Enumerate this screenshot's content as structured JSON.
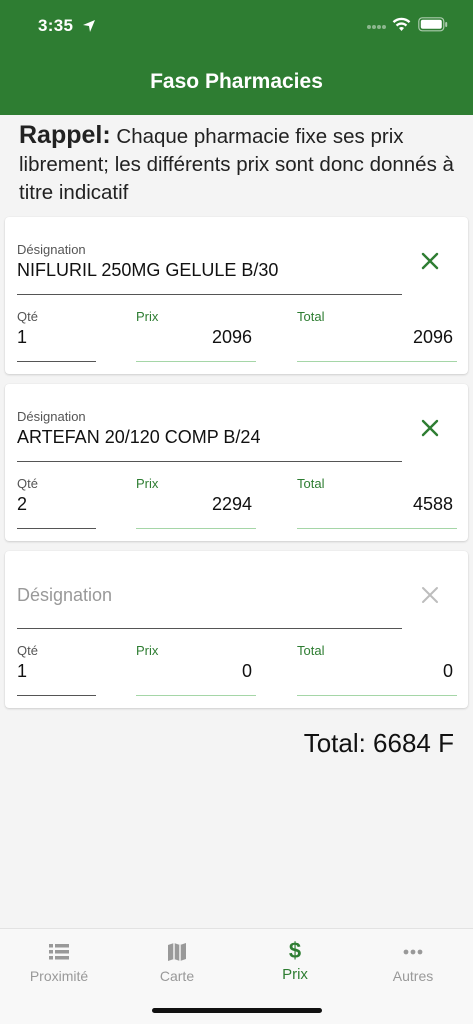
{
  "status_bar": {
    "time": "3:35"
  },
  "header": {
    "title": "Faso Pharmacies"
  },
  "notice": {
    "bold": "Rappel:",
    "text": " Chaque pharmacie fixe ses prix librement; les différents prix sont donc donnés à titre indicatif"
  },
  "labels": {
    "designation": "Désignation",
    "qty": "Qté",
    "price": "Prix",
    "total": "Total"
  },
  "items": [
    {
      "designation": "NIFLURIL 250MG GELULE B/30",
      "qty": "1",
      "price": "2096",
      "total": "2096"
    },
    {
      "designation": "ARTEFAN 20/120 COMP B/24",
      "qty": "2",
      "price": "2294",
      "total": "4588"
    },
    {
      "designation": "",
      "qty": "1",
      "price": "0",
      "total": "0"
    }
  ],
  "grand_total": "Total: 6684 F",
  "tabs": [
    {
      "label": "Proximité",
      "icon": "list-icon"
    },
    {
      "label": "Carte",
      "icon": "map-icon"
    },
    {
      "label": "Prix",
      "icon": "dollar-icon",
      "glyph": "$",
      "active": true
    },
    {
      "label": "Autres",
      "icon": "more-icon"
    }
  ],
  "colors": {
    "primary": "#2e7d32",
    "background": "#f4f4f4",
    "inactive": "#999999"
  }
}
